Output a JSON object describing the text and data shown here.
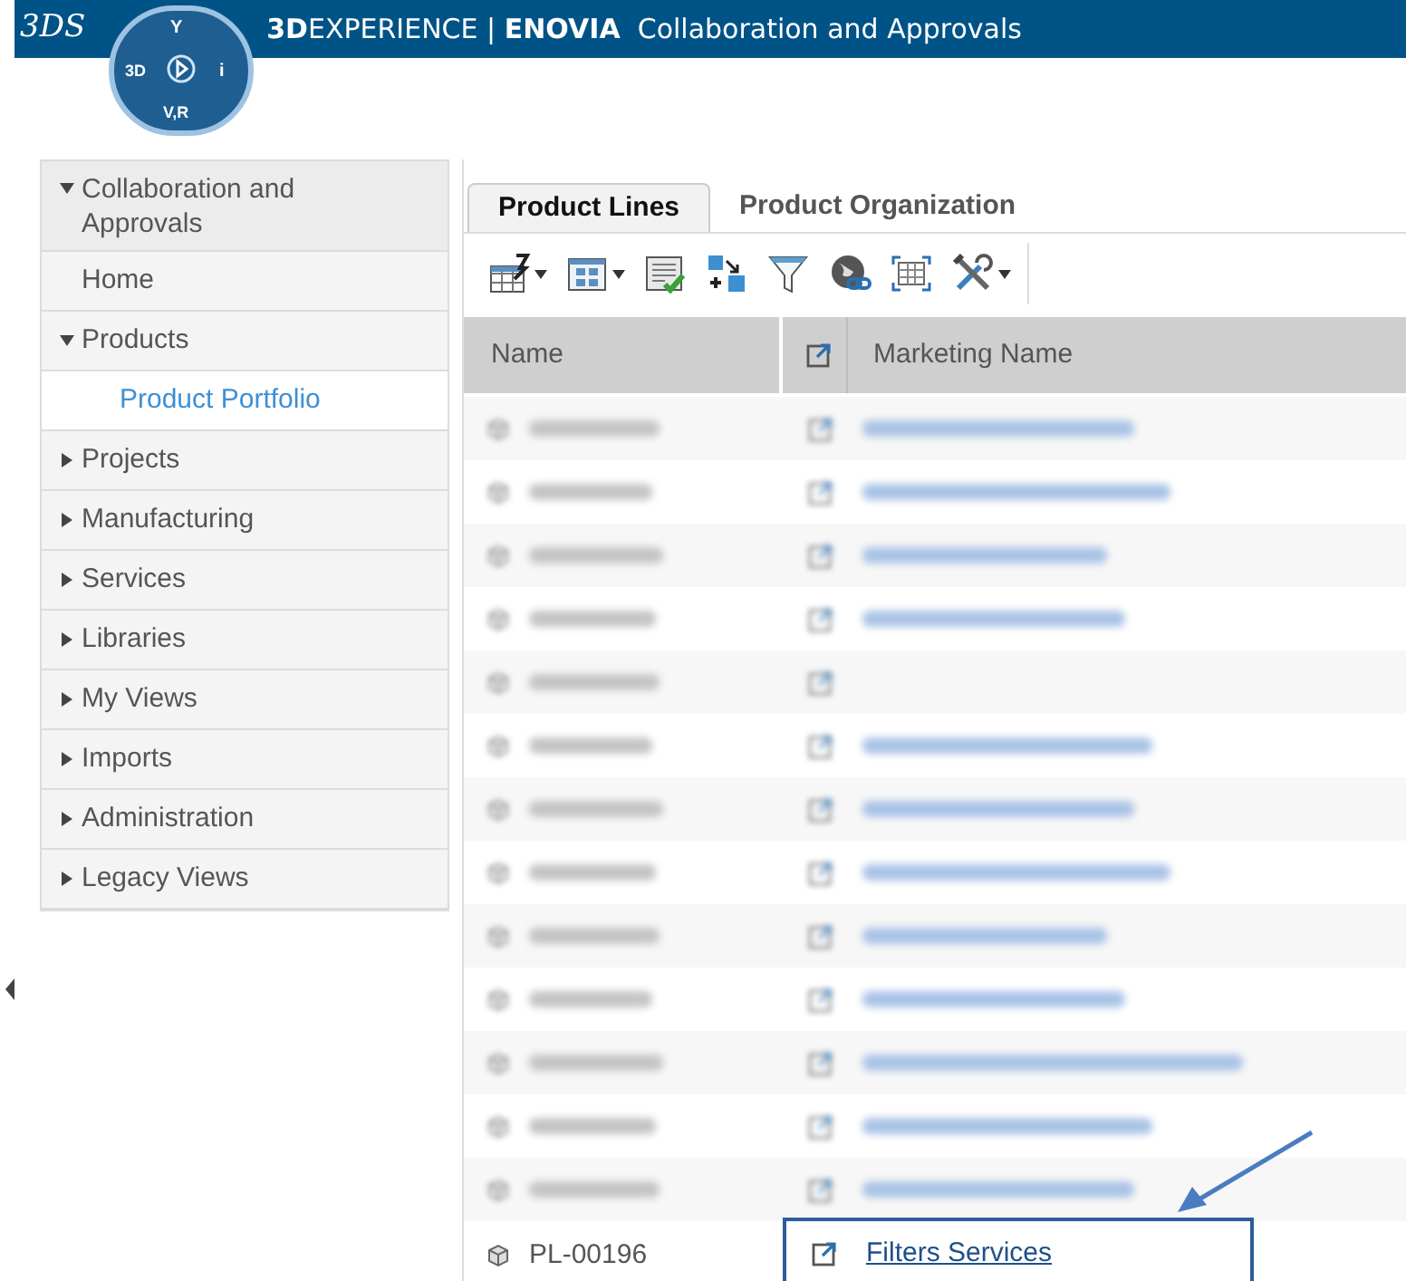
{
  "header": {
    "brand_logo": "3DS",
    "compass": {
      "top": "Y",
      "left": "3D",
      "right": "i",
      "bottom": "V,R"
    },
    "title": "**3D**EXPERIENCE | **ENOVIA**  Collaboration and Approvals"
  },
  "sidebar": {
    "items": [
      {
        "label": "Collaboration and Approvals",
        "expanded": true,
        "children": [
          {
            "label": "Home",
            "kind": "leaf",
            "selected": false
          },
          {
            "label": "Products",
            "kind": "folder",
            "expanded": true,
            "children": [
              {
                "label": "Product Portfolio",
                "kind": "leaf",
                "selected": true
              }
            ]
          },
          {
            "label": "Projects",
            "kind": "folder",
            "expanded": false
          },
          {
            "label": "Manufacturing",
            "kind": "folder",
            "expanded": false
          },
          {
            "label": "Services",
            "kind": "folder",
            "expanded": false
          },
          {
            "label": "Libraries",
            "kind": "folder",
            "expanded": false
          },
          {
            "label": "My Views",
            "kind": "folder",
            "expanded": false
          },
          {
            "label": "Imports",
            "kind": "folder",
            "expanded": false
          },
          {
            "label": "Administration",
            "kind": "folder",
            "expanded": false
          },
          {
            "label": "Legacy Views",
            "kind": "folder",
            "expanded": false
          }
        ]
      }
    ]
  },
  "tabs": [
    {
      "label": "Product Lines",
      "selected": true
    },
    {
      "label": "Product Organization",
      "selected": false
    }
  ],
  "toolbar": [
    {
      "kind": "table-edit",
      "dropdown": true
    },
    {
      "kind": "grid-view",
      "dropdown": true
    },
    {
      "kind": "approve",
      "dropdown": false
    },
    {
      "kind": "add-remove",
      "dropdown": false
    },
    {
      "kind": "filter",
      "dropdown": false
    },
    {
      "kind": "globe-link",
      "dropdown": false
    },
    {
      "kind": "select-table",
      "dropdown": false
    },
    {
      "kind": "tools",
      "dropdown": true
    }
  ],
  "table": {
    "columns": [
      "Name",
      "Marketing Name"
    ],
    "rows": [
      {
        "kind": "blurred",
        "has_marketing_name": true
      },
      {
        "kind": "blurred",
        "has_marketing_name": true
      },
      {
        "kind": "blurred",
        "has_marketing_name": true
      },
      {
        "kind": "blurred",
        "has_marketing_name": true
      },
      {
        "kind": "blurred",
        "has_marketing_name": false
      },
      {
        "kind": "blurred",
        "has_marketing_name": true
      },
      {
        "kind": "blurred",
        "has_marketing_name": true
      },
      {
        "kind": "blurred",
        "has_marketing_name": true
      },
      {
        "kind": "blurred",
        "has_marketing_name": true
      },
      {
        "kind": "blurred",
        "has_marketing_name": true
      },
      {
        "kind": "blurred",
        "has_marketing_name": true
      },
      {
        "kind": "blurred",
        "has_marketing_name": true
      },
      {
        "kind": "blurred",
        "has_marketing_name": true
      },
      {
        "kind": "plain",
        "name": "PL-00196",
        "marketing_name": "Filters Services",
        "highlighted": true
      }
    ]
  }
}
